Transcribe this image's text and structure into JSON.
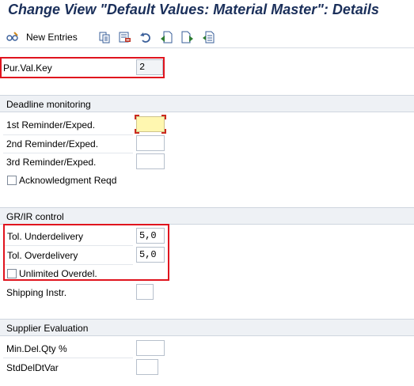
{
  "window": {
    "title": "Change View \"Default Values: Material Master\": Details"
  },
  "toolbar": {
    "new_entries_label": "New Entries",
    "icons": [
      "edit-glasses-icon",
      "copy-icon",
      "delete-icon",
      "undo-icon",
      "previous-entry-icon",
      "next-entry-icon",
      "select-block-icon"
    ]
  },
  "key": {
    "label": "Pur.Val.Key",
    "value": "2"
  },
  "deadline": {
    "title": "Deadline monitoring",
    "reminder1_label": "1st Reminder/Exped.",
    "reminder1_value": "",
    "reminder2_label": "2nd Reminder/Exped.",
    "reminder2_value": "",
    "reminder3_label": "3rd Reminder/Exped.",
    "reminder3_value": "",
    "ack_label": "Acknowledgment Reqd",
    "ack_checked": false
  },
  "grir": {
    "title": "GR/IR control",
    "under_label": "Tol. Underdelivery",
    "under_value": "5,0",
    "over_label": "Tol. Overdelivery",
    "over_value": "5,0",
    "unlimited_label": "Unlimited Overdel.",
    "unlimited_checked": false,
    "shipping_label": "Shipping Instr.",
    "shipping_value": ""
  },
  "supplier": {
    "title": "Supplier Evaluation",
    "mindel_label": "Min.Del.Qty %",
    "mindel_value": "",
    "stddel_label": "StdDelDtVar",
    "stddel_value": ""
  },
  "colors": {
    "title": "#1a2f5a",
    "highlight_border": "#e0141e",
    "required_field": "#fff7b0",
    "section_background": "#eef1f5"
  }
}
